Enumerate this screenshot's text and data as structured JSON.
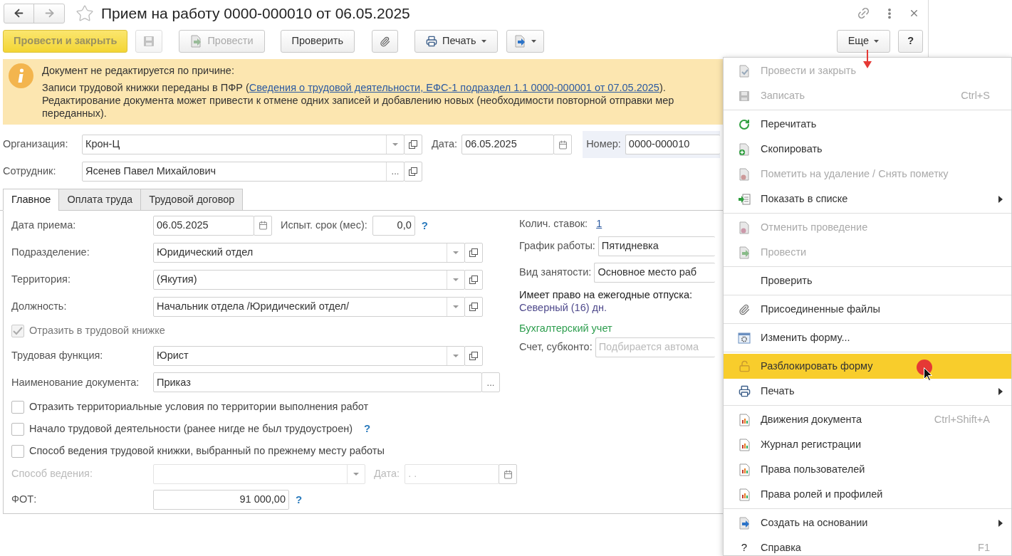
{
  "window": {
    "title": "Прием на работу 0000-000010 от 06.05.2025"
  },
  "toolbar": {
    "left": [
      {
        "kind": "primary",
        "label": "Провести и закрыть",
        "disabled": true
      },
      {
        "kind": "icon",
        "disabled": true
      },
      {
        "kind": "text",
        "label": "Провести",
        "disabled": true
      },
      {
        "kind": "text",
        "label": "Проверить",
        "disabled": false
      },
      {
        "kind": "icon",
        "disabled": false
      },
      {
        "kind": "text",
        "label": "Печать",
        "disabled": false,
        "caret": true
      },
      {
        "kind": "icon",
        "disabled": false,
        "caret": true
      }
    ],
    "right": [
      {
        "kind": "text",
        "label": "Еще",
        "disabled": false,
        "caret": true
      },
      {
        "kind": "text",
        "label": "?",
        "disabled": false
      }
    ]
  },
  "banner": {
    "heading": "Документ не редактируется по причине:",
    "text_before": "Записи трудовой книжки переданы в ПФР (",
    "link": "Сведения о трудовой деятельности, ЕФС-1 подраздел 1.1 0000-000001 от 07.05.2025",
    "text_after": ").",
    "continuation": [
      "Редактирование документа может привести к отмене одних записей и добавлению новых (необходимости повторной отправки мер",
      "переданных)."
    ]
  },
  "header": {
    "organization": {
      "label": "Организация:",
      "value": "Крон-Ц"
    },
    "employee": {
      "label": "Сотрудник:",
      "value": "Ясенев Павел Михайлович",
      "choice_button": "..."
    },
    "date": {
      "label": "Дата:",
      "value": "06.05.2025"
    },
    "number": {
      "label": "Номер:",
      "value": "0000-000010"
    }
  },
  "tabs": [
    {
      "label": "Главное",
      "selected": true
    },
    {
      "label": "Оплата труда",
      "selected": false
    },
    {
      "label": "Трудовой договор",
      "selected": false
    }
  ],
  "main_rows": [
    {
      "kind": "date_probation",
      "label": "Дата приема:",
      "value": "06.05.2025",
      "probation_label": "Испыт. срок (мес):",
      "probation_value": "0,0",
      "help": "?"
    },
    {
      "kind": "select",
      "label": "Подразделение:",
      "value": "Юридический отдел"
    },
    {
      "kind": "select",
      "label": "Территория:",
      "value": "(Якутия)"
    },
    {
      "kind": "select",
      "label": "Должность:",
      "value": "Начальник отдела /Юридический отдел/"
    },
    {
      "kind": "checkbox",
      "label": "Отразить в трудовой книжке",
      "checked": true,
      "disabled": true
    },
    {
      "kind": "select",
      "label": "Трудовая функция:",
      "value": "Юрист"
    },
    {
      "kind": "choice",
      "label": "Наименование документа:",
      "value": "Приказ",
      "choice_button": "..."
    },
    {
      "kind": "checkbox",
      "label": "Отразить территориальные условия по территории выполнения работ",
      "checked": false,
      "disabled": false
    },
    {
      "kind": "checkbox",
      "label": "Начало трудовой деятельности (ранее нигде не был трудоустроен)",
      "checked": false,
      "disabled": false,
      "help": "?"
    },
    {
      "kind": "checkbox",
      "label": "Способ ведения трудовой книжки, выбранный по прежнему месту работы",
      "checked": false,
      "disabled": false
    },
    {
      "kind": "select_date",
      "label": "Способ ведения:",
      "date_label": "Дата:",
      "date_value": ". .",
      "disabled": true
    },
    {
      "kind": "money",
      "label": "ФОТ:",
      "value": "91 000,00",
      "help": "?"
    }
  ],
  "right_column": {
    "rates": {
      "label": "Колич. ставок:",
      "value": "1"
    },
    "schedule": {
      "label": "График работы:",
      "value": "Пятидневка"
    },
    "employment": {
      "label": "Вид занятости:",
      "value": "Основное место раб"
    },
    "vacation": {
      "label": "Имеет право на ежегодные отпуска:",
      "value": "Северный (16) дн."
    },
    "section": "Бухгалтерский учет",
    "account": {
      "label": "Счет, субконто:",
      "placeholder": "Подбирается автома"
    }
  },
  "menu": {
    "groups": [
      [
        {
          "label": "Провести и закрыть",
          "disabled": true,
          "selected": false
        },
        {
          "label": "Записать",
          "disabled": true,
          "shortcut": "Ctrl+S",
          "selected": false
        }
      ],
      [
        {
          "label": "Перечитать",
          "disabled": false,
          "selected": false
        },
        {
          "label": "Скопировать",
          "disabled": false,
          "selected": false
        },
        {
          "label": "Пометить на удаление / Снять пометку",
          "disabled": true,
          "selected": false
        },
        {
          "label": "Показать в списке",
          "disabled": false,
          "submenu": true,
          "selected": false
        }
      ],
      [
        {
          "label": "Отменить проведение",
          "disabled": true,
          "selected": false
        },
        {
          "label": "Провести",
          "disabled": true,
          "selected": false
        }
      ],
      [
        {
          "label": "Проверить",
          "disabled": false,
          "selected": false
        }
      ],
      [
        {
          "label": "Присоединенные файлы",
          "disabled": false,
          "selected": false
        }
      ],
      [
        {
          "label": "Изменить форму...",
          "disabled": false,
          "selected": false
        }
      ],
      [
        {
          "label": "Разблокировать форму",
          "disabled": false,
          "selected": true
        },
        {
          "label": "Печать",
          "disabled": false,
          "submenu": true,
          "selected": false
        }
      ],
      [
        {
          "label": "Движения документа",
          "disabled": false,
          "shortcut": "Ctrl+Shift+A",
          "selected": false
        },
        {
          "label": "Журнал регистрации",
          "disabled": false,
          "selected": false
        },
        {
          "label": "Права пользователей",
          "disabled": false,
          "selected": false
        },
        {
          "label": "Права ролей и профилей",
          "disabled": false,
          "selected": false
        }
      ],
      [
        {
          "label": "Создать на основании",
          "disabled": false,
          "submenu": true,
          "selected": false
        },
        {
          "label": "Справка",
          "disabled": false,
          "shortcut": "F1",
          "glyph": "?",
          "selected": false
        }
      ]
    ]
  }
}
